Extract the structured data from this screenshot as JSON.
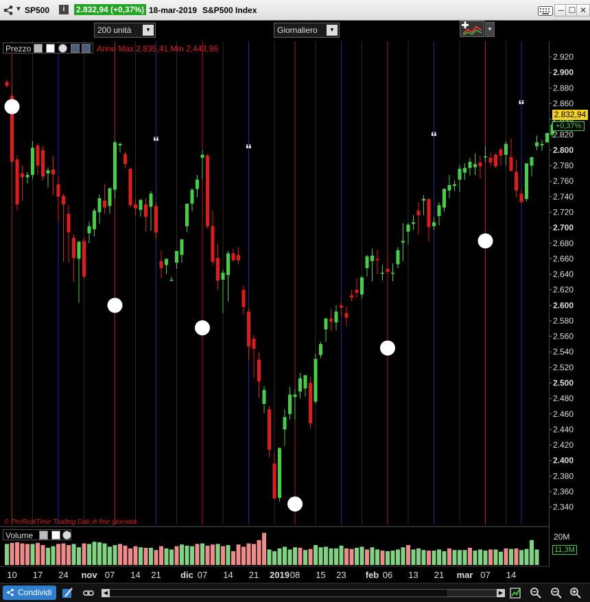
{
  "titlebar": {
    "symbol": "SP500",
    "info_label": "i",
    "price_change": "2.832,94 (+0,37%)",
    "date": "18-mar-2019",
    "name": "S&P500 Index",
    "dropdown_glyph": "▼",
    "minimize_glyph": "─",
    "maximize_glyph": "☐",
    "close_glyph": "✕"
  },
  "toolbar": {
    "units": "200 unità",
    "timeframe": "Giornaliero",
    "arrow_glyph": "▼"
  },
  "price_panel": {
    "label": "Prezzo",
    "annual_info": "Anno Max 2.835,41 Min 2.443,96",
    "watermark": "© ProRealTime Trading  Dati di fine giornata",
    "last_price": "2.832,94",
    "last_change": "+0,37%"
  },
  "volume_panel": {
    "label": "Volume",
    "max_label": "20M",
    "last_volume": "11,3M"
  },
  "bottombar": {
    "share_label": "Condividi",
    "scroll_left": "◀",
    "scroll_right": "▶"
  },
  "colors": {
    "up": "#43d043",
    "down": "#e31a1a",
    "vol_up": "#7fd47f",
    "vol_down": "#f08a8a",
    "red_line": "#b01818",
    "blue_line": "#1f2b9a",
    "gray_line": "#2a2a2a",
    "price_badge": "#f5d21b"
  },
  "chart_data": {
    "type": "candlestick",
    "y_range": [
      2330,
      2930
    ],
    "y_ticks": [
      {
        "v": 2920,
        "label": "2.920",
        "bold": false
      },
      {
        "v": 2900,
        "label": "2.900",
        "bold": true
      },
      {
        "v": 2880,
        "label": "2.880",
        "bold": false
      },
      {
        "v": 2860,
        "label": "2.860",
        "bold": false
      },
      {
        "v": 2840,
        "label": "2.840",
        "bold": false
      },
      {
        "v": 2820,
        "label": "2.820",
        "bold": false
      },
      {
        "v": 2800,
        "label": "2.800",
        "bold": true
      },
      {
        "v": 2780,
        "label": "2.780",
        "bold": false
      },
      {
        "v": 2760,
        "label": "2.760",
        "bold": false
      },
      {
        "v": 2740,
        "label": "2.740",
        "bold": false
      },
      {
        "v": 2720,
        "label": "2.720",
        "bold": false
      },
      {
        "v": 2700,
        "label": "2.700",
        "bold": true
      },
      {
        "v": 2680,
        "label": "2.680",
        "bold": false
      },
      {
        "v": 2660,
        "label": "2.660",
        "bold": false
      },
      {
        "v": 2640,
        "label": "2.640",
        "bold": false
      },
      {
        "v": 2620,
        "label": "2.620",
        "bold": false
      },
      {
        "v": 2600,
        "label": "2.600",
        "bold": true
      },
      {
        "v": 2580,
        "label": "2.580",
        "bold": false
      },
      {
        "v": 2560,
        "label": "2.560",
        "bold": false
      },
      {
        "v": 2540,
        "label": "2.540",
        "bold": false
      },
      {
        "v": 2520,
        "label": "2.520",
        "bold": false
      },
      {
        "v": 2500,
        "label": "2.500",
        "bold": true
      },
      {
        "v": 2480,
        "label": "2.480",
        "bold": false
      },
      {
        "v": 2460,
        "label": "2.460",
        "bold": false
      },
      {
        "v": 2440,
        "label": "2.440",
        "bold": false
      },
      {
        "v": 2420,
        "label": "2.420",
        "bold": false
      },
      {
        "v": 2400,
        "label": "2.400",
        "bold": true
      },
      {
        "v": 2380,
        "label": "2.380",
        "bold": false
      },
      {
        "v": 2360,
        "label": "2.360",
        "bold": false
      },
      {
        "v": 2340,
        "label": "2.340",
        "bold": false
      }
    ],
    "x_ticks": [
      {
        "i": 1,
        "label": "10",
        "bold": false
      },
      {
        "i": 6,
        "label": "17",
        "bold": false
      },
      {
        "i": 11,
        "label": "24",
        "bold": false
      },
      {
        "i": 16,
        "label": "nov",
        "bold": true
      },
      {
        "i": 20,
        "label": "07",
        "bold": false
      },
      {
        "i": 25,
        "label": "14",
        "bold": false
      },
      {
        "i": 29,
        "label": "21",
        "bold": false
      },
      {
        "i": 35,
        "label": "dic",
        "bold": true
      },
      {
        "i": 38,
        "label": "07",
        "bold": false
      },
      {
        "i": 43,
        "label": "14",
        "bold": false
      },
      {
        "i": 48,
        "label": "21",
        "bold": false
      },
      {
        "i": 53,
        "label": "2019",
        "bold": true
      },
      {
        "i": 56,
        "label": "08",
        "bold": false
      },
      {
        "i": 61,
        "label": "15",
        "bold": false
      },
      {
        "i": 65,
        "label": "23",
        "bold": false
      },
      {
        "i": 71,
        "label": "feb",
        "bold": true
      },
      {
        "i": 74,
        "label": "06",
        "bold": false
      },
      {
        "i": 79,
        "label": "13",
        "bold": false
      },
      {
        "i": 84,
        "label": "21",
        "bold": false
      },
      {
        "i": 89,
        "label": "mar",
        "bold": true
      },
      {
        "i": 93,
        "label": "07",
        "bold": false
      },
      {
        "i": 98,
        "label": "14",
        "bold": false
      }
    ],
    "red_lines": [
      1,
      21,
      38,
      56,
      74,
      93
    ],
    "blue_lines": [
      10,
      29,
      47,
      65,
      83,
      100
    ],
    "gray_lines": [
      5,
      15,
      25,
      33,
      42,
      52,
      60,
      69,
      78,
      88,
      97
    ],
    "circle_markers": [
      {
        "i": 1,
        "v": 2856
      },
      {
        "i": 21,
        "v": 2600
      },
      {
        "i": 38,
        "v": 2571
      },
      {
        "i": 56,
        "v": 2344
      },
      {
        "i": 74,
        "v": 2545
      },
      {
        "i": 93,
        "v": 2683
      }
    ],
    "quote_markers": [
      {
        "i": 29,
        "v": 2805
      },
      {
        "i": 47,
        "v": 2795
      },
      {
        "i": 83,
        "v": 2811
      },
      {
        "i": 100,
        "v": 2852
      }
    ],
    "quote_glyph": "“",
    "candles": [
      [
        2888,
        2891,
        2880,
        2883
      ],
      [
        2870,
        2884,
        2778,
        2785
      ],
      [
        2788,
        2793,
        2722,
        2730
      ],
      [
        2770,
        2780,
        2735,
        2765
      ],
      [
        2765,
        2772,
        2757,
        2768
      ],
      [
        2768,
        2812,
        2763,
        2803
      ],
      [
        2806,
        2809,
        2768,
        2780
      ],
      [
        2800,
        2805,
        2761,
        2766
      ],
      [
        2770,
        2778,
        2752,
        2774
      ],
      [
        2775,
        2792,
        2742,
        2769
      ],
      [
        2756,
        2766,
        2708,
        2740
      ],
      [
        2741,
        2744,
        2656,
        2730
      ],
      [
        2718,
        2729,
        2655,
        2694
      ],
      [
        2687,
        2692,
        2630,
        2661
      ],
      [
        2660,
        2683,
        2603,
        2682
      ],
      [
        2683,
        2688,
        2634,
        2637
      ],
      [
        2693,
        2708,
        2680,
        2702
      ],
      [
        2698,
        2725,
        2689,
        2722
      ],
      [
        2720,
        2743,
        2705,
        2738
      ],
      [
        2735,
        2756,
        2718,
        2726
      ],
      [
        2728,
        2740,
        2718,
        2751
      ],
      [
        2749,
        2813,
        2737,
        2810
      ],
      [
        2806,
        2810,
        2797,
        2808
      ],
      [
        2795,
        2798,
        2777,
        2782
      ],
      [
        2776,
        2778,
        2726,
        2729
      ],
      [
        2730,
        2737,
        2715,
        2725
      ],
      [
        2723,
        2735,
        2714,
        2736
      ],
      [
        2730,
        2738,
        2695,
        2714
      ],
      [
        2727,
        2747,
        2696,
        2744
      ],
      [
        2728,
        2733,
        2685,
        2694
      ],
      [
        2657,
        2670,
        2635,
        2648
      ],
      [
        2652,
        2658,
        2640,
        2660
      ],
      [
        2633,
        2637,
        2631,
        2633
      ],
      [
        2655,
        2669,
        2647,
        2670
      ],
      [
        2665,
        2685,
        2655,
        2685
      ],
      [
        2702,
        2728,
        2694,
        2731
      ],
      [
        2731,
        2751,
        2721,
        2749
      ],
      [
        2750,
        2768,
        2739,
        2762
      ],
      [
        2790,
        2800,
        2763,
        2794
      ],
      [
        2793,
        2795,
        2699,
        2702
      ],
      [
        2702,
        2722,
        2652,
        2656
      ],
      [
        2661,
        2679,
        2620,
        2632
      ],
      [
        2633,
        2646,
        2590,
        2642
      ],
      [
        2639,
        2670,
        2605,
        2667
      ],
      [
        2667,
        2673,
        2656,
        2658
      ],
      [
        2665,
        2675,
        2653,
        2658
      ],
      [
        2620,
        2625,
        2588,
        2598
      ],
      [
        2592,
        2597,
        2530,
        2547
      ],
      [
        2557,
        2562,
        2507,
        2544
      ],
      [
        2530,
        2540,
        2481,
        2502
      ],
      [
        2473,
        2496,
        2461,
        2491
      ],
      [
        2466,
        2470,
        2404,
        2414
      ],
      [
        2396,
        2410,
        2350,
        2351
      ],
      [
        2352,
        2417,
        2347,
        2416
      ],
      [
        2440,
        2466,
        2419,
        2456
      ],
      [
        2460,
        2495,
        2453,
        2485
      ],
      [
        2482,
        2493,
        2453,
        2485
      ],
      [
        2489,
        2513,
        2480,
        2506
      ],
      [
        2493,
        2509,
        2482,
        2510
      ],
      [
        2500,
        2508,
        2441,
        2448
      ],
      [
        2476,
        2538,
        2473,
        2531
      ],
      [
        2536,
        2553,
        2532,
        2550
      ],
      [
        2569,
        2584,
        2553,
        2583
      ],
      [
        2583,
        2595,
        2567,
        2579
      ],
      [
        2578,
        2600,
        2568,
        2592
      ],
      [
        2600,
        2604,
        2586,
        2597
      ],
      [
        2590,
        2599,
        2573,
        2584
      ],
      [
        2613,
        2620,
        2605,
        2610
      ],
      [
        2620,
        2635,
        2610,
        2616
      ],
      [
        2614,
        2638,
        2609,
        2636
      ],
      [
        2648,
        2665,
        2637,
        2663
      ],
      [
        2657,
        2673,
        2631,
        2664
      ],
      [
        2660,
        2672,
        2640,
        2658
      ],
      [
        2641,
        2652,
        2632,
        2642
      ],
      [
        2647,
        2664,
        2640,
        2643
      ],
      [
        2641,
        2654,
        2631,
        2642
      ],
      [
        2653,
        2675,
        2648,
        2671
      ],
      [
        2681,
        2706,
        2657,
        2683
      ],
      [
        2695,
        2707,
        2678,
        2704
      ],
      [
        2705,
        2716,
        2697,
        2707
      ],
      [
        2722,
        2733,
        2691,
        2716
      ],
      [
        2735,
        2742,
        2716,
        2737
      ],
      [
        2737,
        2733,
        2682,
        2701
      ],
      [
        2702,
        2714,
        2697,
        2707
      ],
      [
        2715,
        2733,
        2703,
        2729
      ],
      [
        2726,
        2751,
        2721,
        2750
      ],
      [
        2748,
        2768,
        2738,
        2755
      ],
      [
        2754,
        2761,
        2747,
        2756
      ],
      [
        2762,
        2781,
        2746,
        2776
      ],
      [
        2771,
        2783,
        2762,
        2777
      ],
      [
        2777,
        2790,
        2767,
        2785
      ],
      [
        2778,
        2796,
        2768,
        2782
      ],
      [
        2784,
        2793,
        2763,
        2779
      ],
      [
        2791,
        2805,
        2784,
        2792
      ],
      [
        2790,
        2797,
        2779,
        2784
      ],
      [
        2794,
        2796,
        2777,
        2779
      ],
      [
        2801,
        2803,
        2780,
        2793
      ],
      [
        2794,
        2811,
        2780,
        2808
      ],
      [
        2791,
        2815,
        2784,
        2773
      ],
      [
        2772,
        2787,
        2739,
        2748
      ],
      [
        2744,
        2750,
        2730,
        2733
      ],
      [
        2737,
        2775,
        2734,
        2783
      ],
      [
        2780,
        2788,
        2766,
        2791
      ],
      [
        2805,
        2819,
        2800,
        2810
      ],
      [
        2806,
        2813,
        2799,
        2808
      ],
      [
        2810,
        2822,
        2812,
        2822
      ],
      [
        2820,
        2838,
        2816,
        2833
      ]
    ],
    "volumes": [
      [
        3.8,
        1
      ],
      [
        4.0,
        0
      ],
      [
        4.1,
        0
      ],
      [
        3.9,
        0
      ],
      [
        3.8,
        0
      ],
      [
        3.8,
        1
      ],
      [
        4.0,
        0
      ],
      [
        3.6,
        0
      ],
      [
        3.1,
        1
      ],
      [
        3.4,
        1
      ],
      [
        3.8,
        0
      ],
      [
        3.9,
        0
      ],
      [
        3.6,
        0
      ],
      [
        3.8,
        1
      ],
      [
        3.2,
        1
      ],
      [
        3.9,
        0
      ],
      [
        3.8,
        1
      ],
      [
        4.2,
        1
      ],
      [
        4.1,
        1
      ],
      [
        3.9,
        1
      ],
      [
        3.3,
        1
      ],
      [
        3.6,
        1
      ],
      [
        3.8,
        0
      ],
      [
        3.5,
        0
      ],
      [
        3.0,
        0
      ],
      [
        3.4,
        0
      ],
      [
        3.2,
        1
      ],
      [
        3.1,
        0
      ],
      [
        3.1,
        1
      ],
      [
        2.7,
        0
      ],
      [
        3.4,
        0
      ],
      [
        3.0,
        1
      ],
      [
        2.8,
        1
      ],
      [
        3.4,
        0
      ],
      [
        3.7,
        1
      ],
      [
        3.5,
        1
      ],
      [
        3.4,
        1
      ],
      [
        3.8,
        0
      ],
      [
        3.9,
        1
      ],
      [
        3.5,
        0
      ],
      [
        3.7,
        0
      ],
      [
        3.8,
        1
      ],
      [
        3.4,
        0
      ],
      [
        3.6,
        1
      ],
      [
        2.5,
        0
      ],
      [
        3.7,
        0
      ],
      [
        3.3,
        0
      ],
      [
        3.9,
        0
      ],
      [
        3.8,
        0
      ],
      [
        4.5,
        0
      ],
      [
        5.8,
        0
      ],
      [
        2.8,
        1
      ],
      [
        2.5,
        1
      ],
      [
        3.0,
        1
      ],
      [
        3.3,
        1
      ],
      [
        2.8,
        1
      ],
      [
        3.2,
        1
      ],
      [
        3.1,
        0
      ],
      [
        2.7,
        1
      ],
      [
        2.9,
        0
      ],
      [
        3.6,
        1
      ],
      [
        3.2,
        1
      ],
      [
        3.3,
        1
      ],
      [
        3.0,
        1
      ],
      [
        3.0,
        1
      ],
      [
        3.5,
        1
      ],
      [
        3.0,
        0
      ],
      [
        2.9,
        0
      ],
      [
        3.1,
        1
      ],
      [
        3.3,
        1
      ],
      [
        2.8,
        0
      ],
      [
        3.2,
        1
      ],
      [
        2.8,
        1
      ],
      [
        2.6,
        0
      ],
      [
        2.5,
        1
      ],
      [
        2.6,
        1
      ],
      [
        2.8,
        1
      ],
      [
        3.2,
        1
      ],
      [
        3.6,
        0
      ],
      [
        2.8,
        1
      ],
      [
        3.0,
        1
      ],
      [
        2.7,
        1
      ],
      [
        2.6,
        0
      ],
      [
        2.6,
        1
      ],
      [
        2.8,
        1
      ],
      [
        2.5,
        1
      ],
      [
        3.0,
        0
      ],
      [
        2.7,
        1
      ],
      [
        2.7,
        1
      ],
      [
        2.7,
        1
      ],
      [
        3.1,
        0
      ],
      [
        2.6,
        1
      ],
      [
        2.8,
        1
      ],
      [
        2.6,
        1
      ],
      [
        2.8,
        0
      ],
      [
        2.8,
        1
      ],
      [
        2.4,
        1
      ],
      [
        3.0,
        0
      ],
      [
        2.9,
        1
      ],
      [
        3.0,
        0
      ],
      [
        2.7,
        1
      ],
      [
        2.9,
        1
      ],
      [
        4.5,
        1
      ],
      [
        2.8,
        1
      ]
    ]
  }
}
